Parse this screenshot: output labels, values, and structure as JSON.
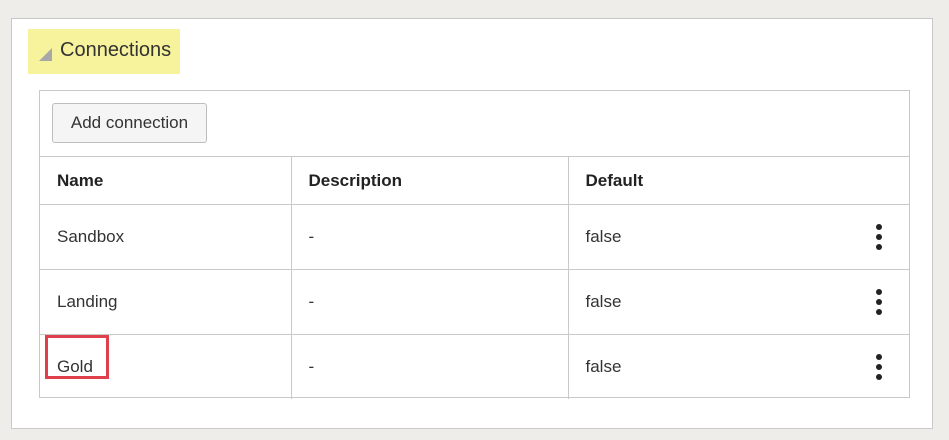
{
  "section": {
    "title": "Connections",
    "highlight_color": "#f7f29c"
  },
  "toolbar": {
    "add_label": "Add connection"
  },
  "table": {
    "columns": [
      "Name",
      "Description",
      "Default"
    ],
    "rows": [
      {
        "name": "Sandbox",
        "description": "-",
        "default": "false"
      },
      {
        "name": "Landing",
        "description": "-",
        "default": "false"
      },
      {
        "name": "Gold",
        "description": "-",
        "default": "false"
      }
    ]
  },
  "annotation": {
    "highlighted_row": "Gold",
    "color": "#e0404b"
  },
  "icons": {
    "collapse": "collapse-triangle-icon",
    "row_actions": "kebab-menu-icon"
  }
}
